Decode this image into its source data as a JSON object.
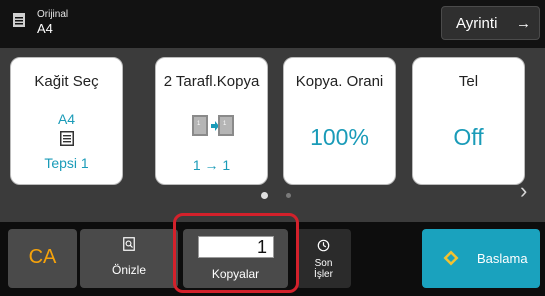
{
  "topbar": {
    "original_label": "Orijinal",
    "original_size": "A4",
    "detail_label": "Ayrinti",
    "detail_arrow": "→"
  },
  "cards": {
    "paper": {
      "title": "Kağit Seç",
      "size": "A4",
      "tray": "Tepsi 1"
    },
    "duplex": {
      "title": "2 Tarafl.Kopya",
      "mode": "1 → 1"
    },
    "ratio": {
      "title": "Kopya. Orani",
      "value": "100%"
    },
    "tel": {
      "title": "Tel",
      "value": "Off"
    }
  },
  "pagination": {
    "current": 1,
    "total": 2,
    "next_arrow": "›"
  },
  "bottombar": {
    "ca_label": "CA",
    "preview_label": "Önizle",
    "copies_value": "1",
    "copies_label": "Kopyalar",
    "history_line1": "Son",
    "history_line2": "İşler",
    "start_label": "Baslama"
  },
  "colors": {
    "accent_teal": "#1a9bb8",
    "start_button": "#1aa2be",
    "ca_orange": "#f5a20b",
    "highlight_red": "#d3212b"
  },
  "icons": {
    "original": "document-icon",
    "paper": "paper-tray-icon",
    "duplex": "duplex-copy-icon",
    "preview": "preview-icon",
    "history": "history-icon",
    "start": "start-icon"
  }
}
